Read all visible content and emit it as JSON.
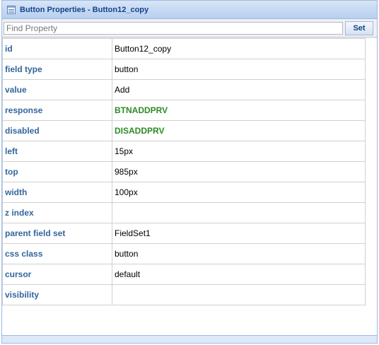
{
  "window": {
    "title": "Button Properties - Button12_copy",
    "icon": "properties-grid-icon"
  },
  "toolbar": {
    "search_placeholder": "Find Property",
    "search_value": "",
    "set_label": "Set"
  },
  "properties": [
    {
      "name": "id",
      "value": "Button12_copy"
    },
    {
      "name": "field type",
      "value": "button"
    },
    {
      "name": "value",
      "value": "Add"
    },
    {
      "name": "response",
      "value": "BTNADDPRV"
    },
    {
      "name": "disabled",
      "value": "DISADDPRV"
    },
    {
      "name": "left",
      "value": "15px"
    },
    {
      "name": "top",
      "value": "985px"
    },
    {
      "name": "width",
      "value": "100px"
    },
    {
      "name": "z index",
      "value": ""
    },
    {
      "name": "parent field set",
      "value": "FieldSet1"
    },
    {
      "name": "css class",
      "value": "button"
    },
    {
      "name": "cursor",
      "value": "default"
    },
    {
      "name": "visibility",
      "value": ""
    }
  ],
  "colors": {
    "link_value": "#2e8b24",
    "property_name": "#33669b",
    "title": "#15428b"
  }
}
